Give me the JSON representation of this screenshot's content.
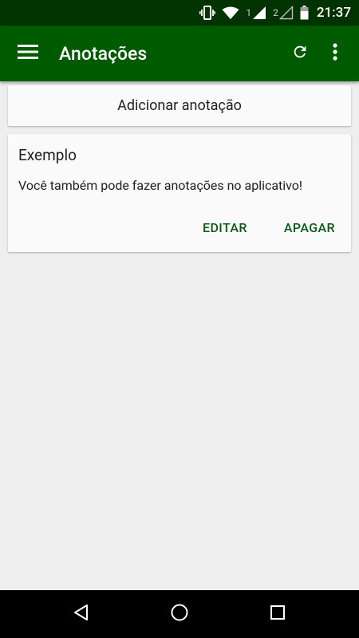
{
  "status_bar": {
    "sim1": "1",
    "sim2": "2",
    "time": "21:37",
    "icons": [
      "vibrate-icon",
      "wifi-icon",
      "signal-1-icon",
      "signal-2-icon",
      "battery-icon"
    ]
  },
  "app_bar": {
    "title": "Anotações",
    "icons": [
      "menu-icon",
      "refresh-icon",
      "more-vert-icon"
    ],
    "color": "#005a00"
  },
  "add_note": {
    "label": "Adicionar anotação"
  },
  "notes": [
    {
      "title": "Exemplo",
      "body": "Você também pode fazer anotações no aplicativo!",
      "edit_label": "EDITAR",
      "delete_label": "APAGAR"
    }
  ],
  "nav_bar": {
    "icons": [
      "back-icon",
      "home-icon",
      "recents-icon"
    ]
  },
  "colors": {
    "status_bar": "#003300",
    "app_bar": "#005a00",
    "accent_text": "#0b5a14",
    "background": "#eeeeee"
  }
}
